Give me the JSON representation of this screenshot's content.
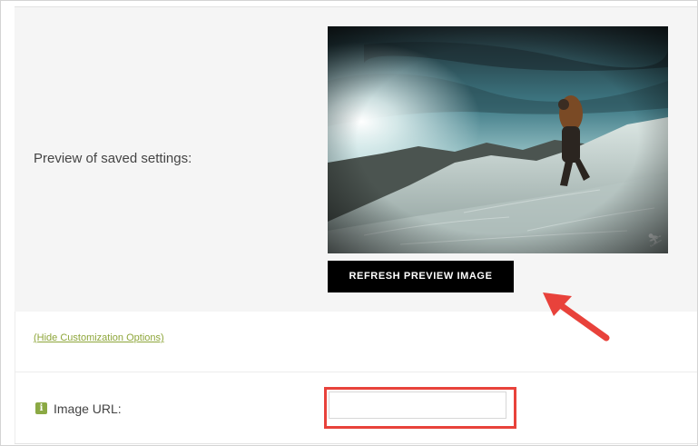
{
  "preview": {
    "label": "Preview of saved settings:",
    "image_alt": "hiker climbing snowy mountain ridge",
    "refresh_button": "REFRESH PREVIEW IMAGE"
  },
  "customization": {
    "hide_link": "(Hide Customization Options)"
  },
  "fields": {
    "image_url": {
      "label": "Image URL:",
      "info_icon": "info-icon",
      "value": "",
      "placeholder": ""
    }
  },
  "colors": {
    "accent_green": "#8ea63a",
    "annotation_red": "#e8423b",
    "button_bg": "#000000"
  }
}
